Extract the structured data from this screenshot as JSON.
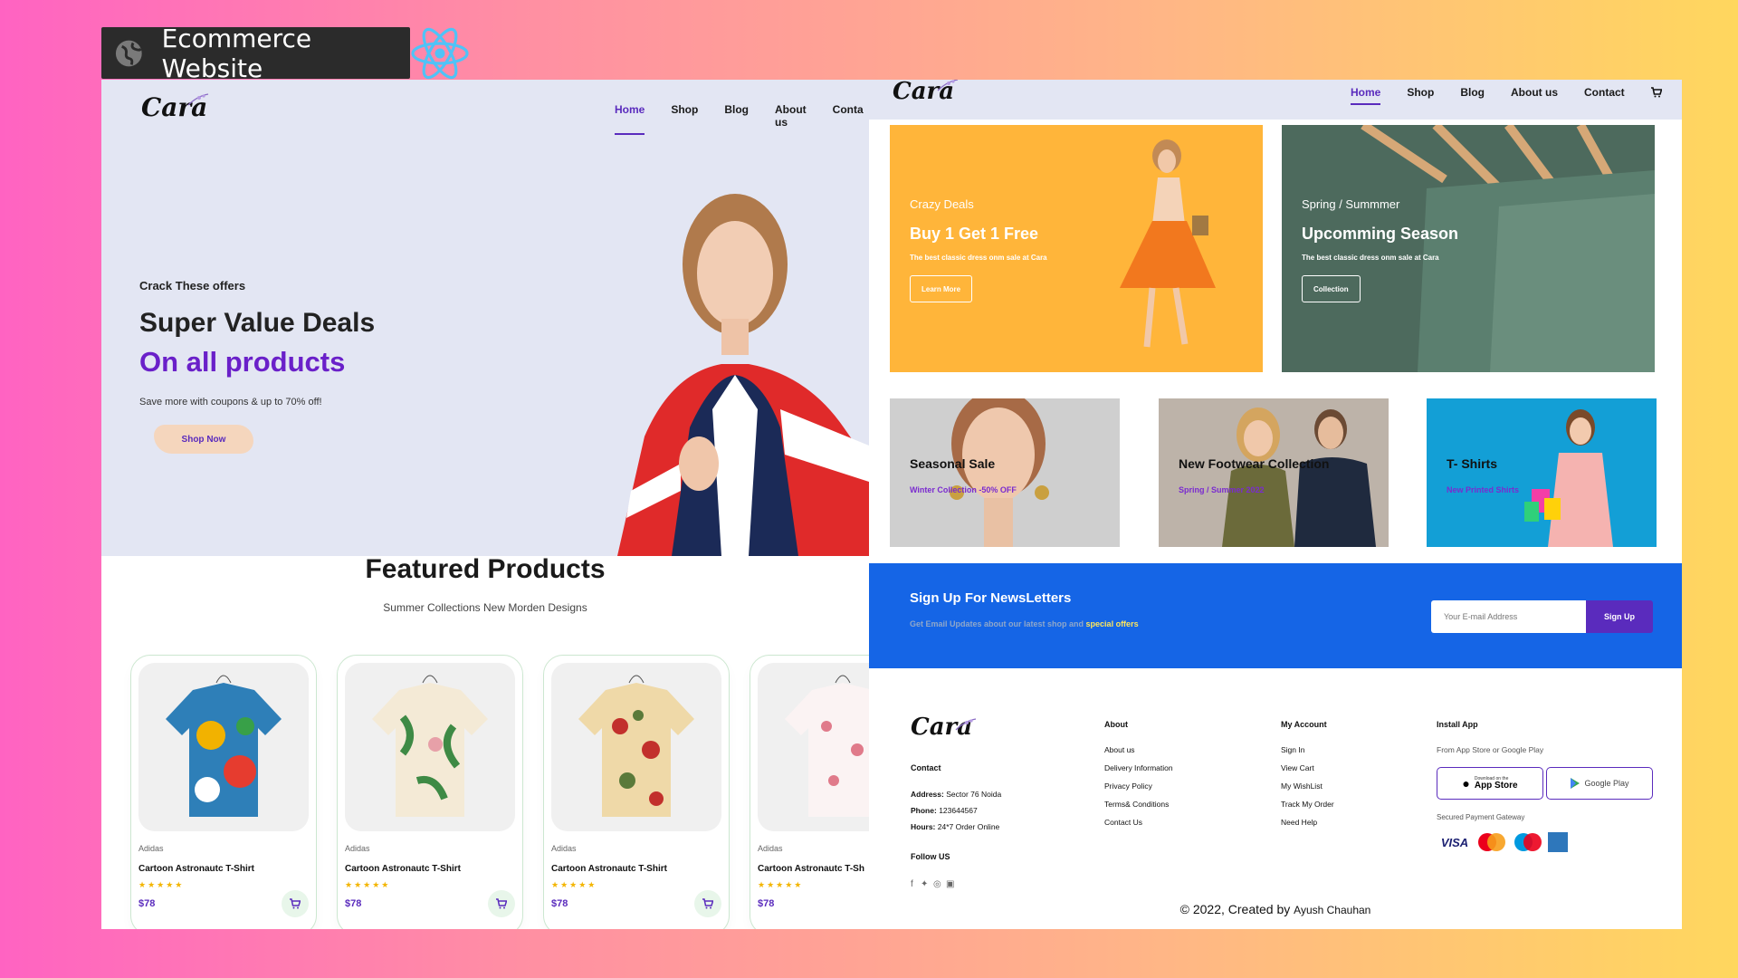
{
  "badge": {
    "title": "Ecommerce Website",
    "icon": "globe-icon",
    "framework_icon": "react-logo-icon"
  },
  "brand": {
    "logo": "Cara"
  },
  "nav": {
    "items": [
      "Home",
      "Shop",
      "Blog",
      "About us",
      "Conta"
    ],
    "active": "Home"
  },
  "nav_right": {
    "items": [
      "Home",
      "Shop",
      "Blog",
      "About us",
      "Contact"
    ],
    "cart_icon": "cart-icon"
  },
  "hero": {
    "kicker": "Crack These offers",
    "title1": "Super Value Deals",
    "title2": "On all products",
    "subtitle": "Save more with coupons & up to 70% off!",
    "button": "Shop Now"
  },
  "featured": {
    "title": "Featured Products",
    "subtitle": "Summer Collections New Morden Designs",
    "products": [
      {
        "brand": "Adidas",
        "name": "Cartoon Astronautc T-Shirt",
        "stars": "★★★★★",
        "price": "$78"
      },
      {
        "brand": "Adidas",
        "name": "Cartoon Astronautc T-Shirt",
        "stars": "★★★★★",
        "price": "$78"
      },
      {
        "brand": "Adidas",
        "name": "Cartoon Astronautc T-Shirt",
        "stars": "★★★★★",
        "price": "$78"
      },
      {
        "brand": "Adidas",
        "name": "Cartoon Astronautc T-Sh",
        "stars": "★★★★★",
        "price": "$78"
      }
    ]
  },
  "banners_big": [
    {
      "kicker": "Crazy Deals",
      "title": "Buy 1 Get 1 Free",
      "text": "The best classic dress onm sale at Cara",
      "button": "Learn More",
      "color": "#ffb53a"
    },
    {
      "kicker": "Spring / Summmer",
      "title": "Upcomming Season",
      "text": "The best classic dress onm sale at Cara",
      "button": "Collection",
      "color": "#5f7a6d"
    }
  ],
  "banners_small": [
    {
      "title": "Seasonal Sale",
      "subtitle": "Winter Collection -50% OFF"
    },
    {
      "title": "New Footwear Collection",
      "subtitle": "Spring / Summer 2022"
    },
    {
      "title": "T- Shirts",
      "subtitle": "New Printed Shirts"
    }
  ],
  "newsletter": {
    "title": "Sign Up For NewsLetters",
    "subtitle": "Get Email Updates about our latest shop and",
    "highlight": "special offers",
    "placeholder": "Your E-mail Address",
    "button": "Sign Up"
  },
  "footer": {
    "contact": {
      "heading": "Contact",
      "address_label": "Address:",
      "address": "Sector 76 Noida",
      "phone_label": "Phone:",
      "phone": "123644567",
      "hours_label": "Hours:",
      "hours": "24*7 Order Online",
      "follow": "Follow US"
    },
    "about": {
      "heading": "About",
      "links": [
        "About us",
        "Delivery Information",
        "Privacy Policy",
        "Terms& Conditions",
        "Contact Us"
      ]
    },
    "account": {
      "heading": "My Account",
      "links": [
        "Sign In",
        "View Cart",
        "My WishList",
        "Track My Order",
        "Need Help"
      ]
    },
    "install": {
      "heading": "Install App",
      "text": "From App Store or Google Play",
      "appstore_small": "Download on the",
      "appstore": "App Store",
      "googleplay": "Google Play",
      "payment": "Secured Payment Gateway",
      "cards": [
        "VISA",
        "MasterCard",
        "Maestro",
        "AMEX"
      ]
    },
    "copyright": "© 2022, Created by",
    "author": "Ayush Chauhan"
  }
}
